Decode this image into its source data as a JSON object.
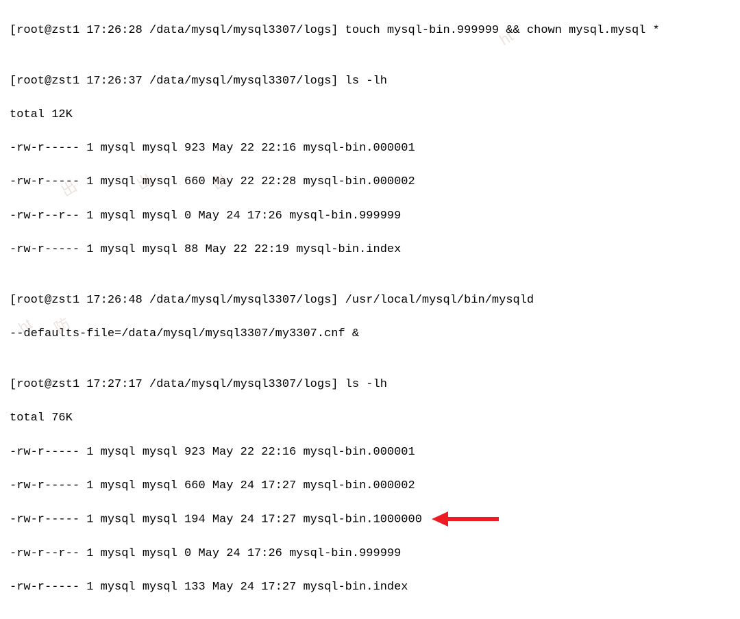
{
  "l1": "[root@zst1 17:26:28 /data/mysql/mysql3307/logs] touch mysql-bin.999999 && chown mysql.mysql *",
  "blank": "",
  "l2": "[root@zst1 17:26:37 /data/mysql/mysql3307/logs] ls -lh",
  "l3": "total 12K",
  "l4": "-rw-r----- 1 mysql mysql 923 May 22 22:16 mysql-bin.000001",
  "l5": "-rw-r----- 1 mysql mysql 660 May 22 22:28 mysql-bin.000002",
  "l6": "-rw-r--r-- 1 mysql mysql 0 May 24 17:26 mysql-bin.999999",
  "l7": "-rw-r----- 1 mysql mysql 88 May 22 22:19 mysql-bin.index",
  "l8": "[root@zst1 17:26:48 /data/mysql/mysql3307/logs] /usr/local/mysql/bin/mysqld",
  "l9": "--defaults-file=/data/mysql/mysql3307/my3307.cnf &",
  "l10": "[root@zst1 17:27:17 /data/mysql/mysql3307/logs] ls -lh",
  "l11": "total 76K",
  "l12": "-rw-r----- 1 mysql mysql 923 May 22 22:16 mysql-bin.000001",
  "l13": "-rw-r----- 1 mysql mysql 660 May 24 17:27 mysql-bin.000002",
  "l14": "-rw-r----- 1 mysql mysql 194 May 24 17:27 mysql-bin.1000000",
  "l15": "-rw-r--r-- 1 mysql mysql 0 May 24 17:26 mysql-bin.999999",
  "l16": "-rw-r----- 1 mysql mysql 133 May 24 17:27 mysql-bin.index",
  "arrow_color": "#ed1c24"
}
